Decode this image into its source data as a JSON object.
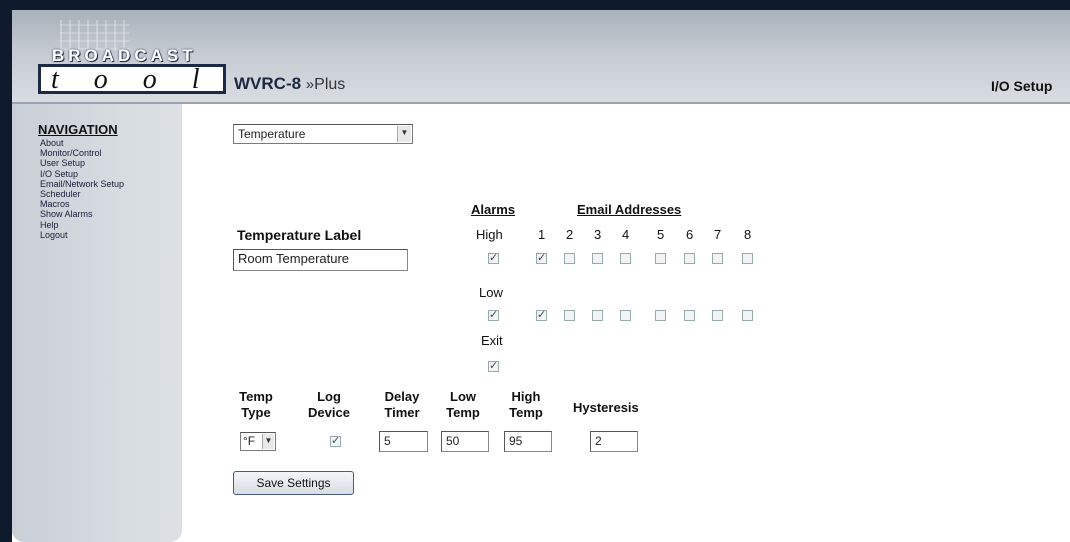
{
  "header": {
    "brand_top": "BROADCAST",
    "brand_bottom": "t o o l s",
    "product_name": "WVRC-8",
    "product_separator": "»",
    "product_suffix": "Plus",
    "section_title": "I/O Setup"
  },
  "navigation": {
    "title": "NAVIGATION",
    "items": [
      "About",
      "Monitor/Control",
      "User Setup",
      "I/O Setup",
      "Email/Network Setup",
      "Scheduler",
      "Macros",
      "Show Alarms",
      "Help",
      "Logout"
    ]
  },
  "io_type_select": {
    "value": "Temperature"
  },
  "temperature_label": {
    "heading": "Temperature Label",
    "value": "Room Temperature"
  },
  "alarms": {
    "heading": "Alarms",
    "high_label": "High",
    "low_label": "Low",
    "exit_label": "Exit",
    "high_checked": true,
    "low_checked": true,
    "exit_checked": true
  },
  "email_addresses": {
    "heading": "Email Addresses",
    "numbers": [
      "1",
      "2",
      "3",
      "4",
      "5",
      "6",
      "7",
      "8"
    ],
    "high_checked": [
      true,
      false,
      false,
      false,
      false,
      false,
      false,
      false
    ],
    "low_checked": [
      true,
      false,
      false,
      false,
      false,
      false,
      false,
      false
    ]
  },
  "settings": {
    "temp_type_label_1": "Temp",
    "temp_type_label_2": "Type",
    "temp_type_value": "°F",
    "log_device_label_1": "Log",
    "log_device_label_2": "Device",
    "log_device_checked": true,
    "delay_timer_label_1": "Delay",
    "delay_timer_label_2": "Timer",
    "delay_timer_value": "5",
    "low_temp_label_1": "Low",
    "low_temp_label_2": "Temp",
    "low_temp_value": "50",
    "high_temp_label_1": "High",
    "high_temp_label_2": "Temp",
    "high_temp_value": "95",
    "hysteresis_label": "Hysteresis",
    "hysteresis_value": "2"
  },
  "save_button": "Save Settings"
}
